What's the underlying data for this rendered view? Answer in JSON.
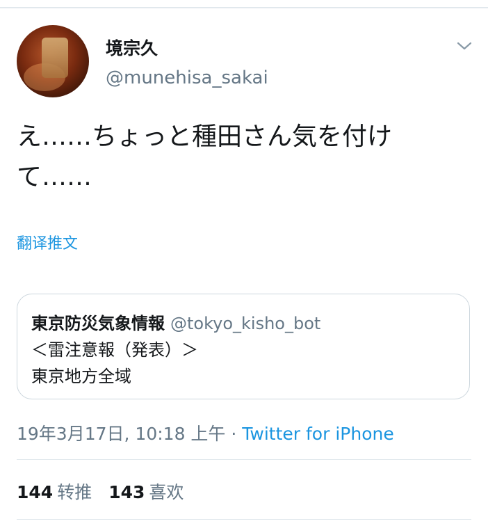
{
  "author": {
    "display_name": "境宗久",
    "handle": "@munehisa_sakai"
  },
  "tweet": {
    "text": "え……ちょっと種田さん気を付けて……",
    "translate_label": "翻译推文"
  },
  "quote": {
    "name": "東京防災気象情報",
    "handle": "@tokyo_kisho_bot",
    "line1": "＜雷注意報（発表）＞",
    "line2": "東京地方全域"
  },
  "meta": {
    "timestamp": "19年3月17日, 10:18 上午",
    "separator": " · ",
    "source": "Twitter for iPhone"
  },
  "stats": {
    "retweets_count": "144",
    "retweets_label": "转推",
    "likes_count": "143",
    "likes_label": "喜欢"
  },
  "icons": {
    "menu": "chevron-down-icon"
  },
  "colors": {
    "link": "#1b95e0",
    "secondary_text": "#657786",
    "primary_text": "#14171a",
    "border": "#ccd6dd"
  }
}
